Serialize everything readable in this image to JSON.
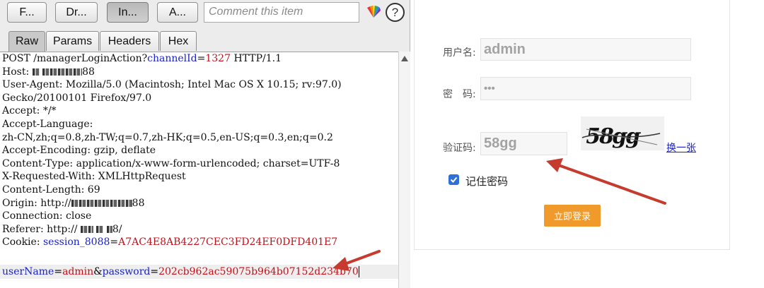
{
  "toolbar": {
    "buttons": [
      "F...",
      "Dr...",
      "In...",
      "A..."
    ],
    "comment_placeholder": "Comment this item",
    "help_label": "?"
  },
  "tabs": [
    "Raw",
    "Params",
    "Headers",
    "Hex"
  ],
  "request": {
    "method": "POST",
    "path": "/managerLoginAction?",
    "query_key": "channelId",
    "query_value": "1327",
    "protocol": "HTTP/1.1",
    "host_label": "Host:",
    "host_suffix": "88",
    "user_agent": "User-Agent: Mozilla/5.0 (Macintosh; Intel Mac OS X 10.15; rv:97.0)",
    "gecko": "Gecko/20100101 Firefox/97.0",
    "accept": "Accept: */*",
    "accept_language_label": "Accept-Language:",
    "accept_language": "zh-CN,zh;q=0.8,zh-TW;q=0.7,zh-HK;q=0.5,en-US;q=0.3,en;q=0.2",
    "accept_encoding": "Accept-Encoding: gzip, deflate",
    "content_type": "Content-Type: application/x-www-form-urlencoded; charset=UTF-8",
    "x_requested_with": "X-Requested-With: XMLHttpRequest",
    "content_length": "Content-Length: 69",
    "origin_label": "Origin: http://",
    "origin_suffix": "88",
    "connection": "Connection: close",
    "referer_label": "Referer: http://",
    "referer_suffix": "8/",
    "cookie_label": "Cookie:",
    "cookie_key": "session_8088",
    "cookie_value": "A7AC4E8AB4227CEC3FD24EF0DFD401E7",
    "body_user_key": "userName",
    "body_user_value": "admin",
    "body_pass_key": "password",
    "body_pass_value": "202cb962ac59075b964b07152d234b70"
  },
  "login": {
    "username_label": "用户名:",
    "username_value": "admin",
    "password_label": "密　码:",
    "password_value": "•••",
    "captcha_label": "验证码:",
    "captcha_value": "58gg",
    "captcha_image_text": "58gg",
    "refresh_label": "换一张",
    "remember_label": "记住密码",
    "remember_checked": true,
    "submit_label": "立即登录"
  },
  "colors": {
    "param_key": "#1a22c8",
    "param_value": "#c2101a",
    "submit_button": "#ef9a2a",
    "arrow": "#c73a2e",
    "checkbox": "#2e6fd9"
  },
  "icons": [
    "highlight-icon",
    "help-icon",
    "scroll-up-icon",
    "check-icon",
    "arrow-annotation"
  ]
}
